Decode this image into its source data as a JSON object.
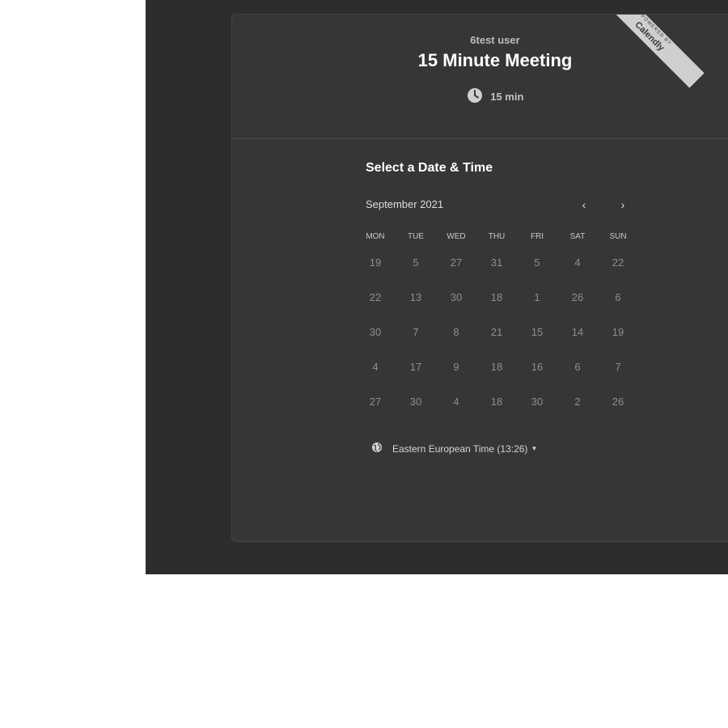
{
  "ribbon": {
    "top": "POWERED BY",
    "brand": "Calendly"
  },
  "event": {
    "owner": "6test user",
    "title": "15 Minute Meeting",
    "duration": "15 min"
  },
  "picker": {
    "heading": "Select a Date & Time",
    "month": "September 2021",
    "prev_label": "‹",
    "next_label": "›",
    "weekdays": [
      "MON",
      "TUE",
      "WED",
      "THU",
      "FRI",
      "SAT",
      "SUN"
    ],
    "weeks": [
      [
        "19",
        "5",
        "27",
        "31",
        "5",
        "4",
        "22"
      ],
      [
        "22",
        "13",
        "30",
        "18",
        "1",
        "26",
        "6"
      ],
      [
        "30",
        "7",
        "8",
        "21",
        "15",
        "14",
        "19"
      ],
      [
        "4",
        "17",
        "9",
        "18",
        "16",
        "6",
        "7"
      ],
      [
        "27",
        "30",
        "4",
        "18",
        "30",
        "2",
        "26"
      ]
    ]
  },
  "timezone": {
    "label": "Eastern European Time (13:26)",
    "caret": "▼"
  }
}
